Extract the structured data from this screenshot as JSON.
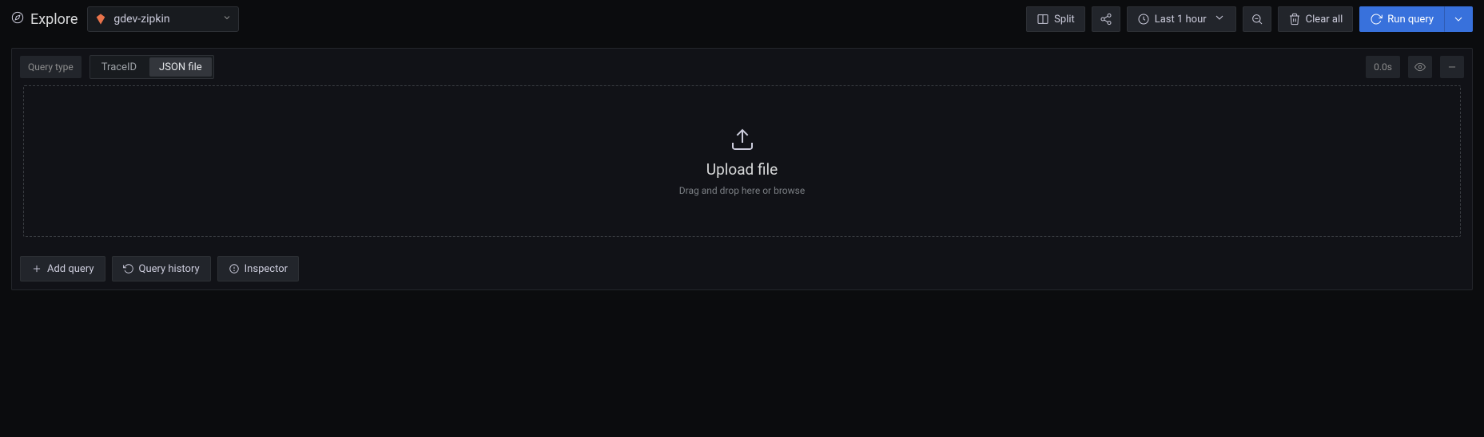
{
  "header": {
    "title": "Explore",
    "datasource": "gdev-zipkin",
    "split": "Split",
    "time_range": "Last 1 hour",
    "clear_all": "Clear all",
    "run_query": "Run query"
  },
  "query": {
    "type_label": "Query type",
    "radio_options": [
      "TraceID",
      "JSON file"
    ],
    "radio_selected": 1,
    "timing": "0.0s"
  },
  "dropzone": {
    "title": "Upload file",
    "sub": "Drag and drop here or browse"
  },
  "footer": {
    "add_query": "Add query",
    "query_history": "Query history",
    "inspector": "Inspector"
  }
}
